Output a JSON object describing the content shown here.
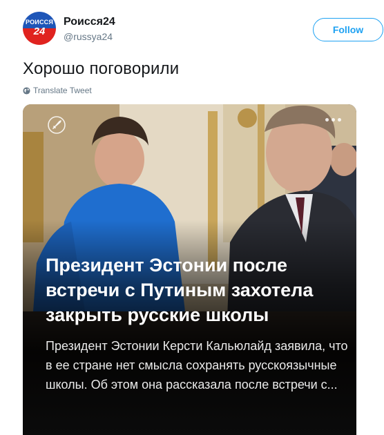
{
  "account": {
    "avatar_top": "РОИССЯ",
    "avatar_bottom": "24",
    "name": "Роисся24",
    "handle": "@russya24"
  },
  "follow_button": {
    "label": "Follow"
  },
  "tweet": {
    "text": "Хорошо поговорили",
    "translate_label": "Translate Tweet"
  },
  "card": {
    "headline": "Президент Эстонии после встречи с Путиным захотела закрыть русские школы",
    "description": "Президент Эстонии Керсти Кальюлайд заявила, что в ее стране нет смысла сохранять русскоязычные школы. Об этом она рассказала после встречи с..."
  },
  "colors": {
    "accent": "#1da1f2",
    "secondary_text": "#657786",
    "primary_text": "#14171a"
  },
  "icons": [
    "globe-icon",
    "rocket-icon",
    "more-dots-icon"
  ]
}
